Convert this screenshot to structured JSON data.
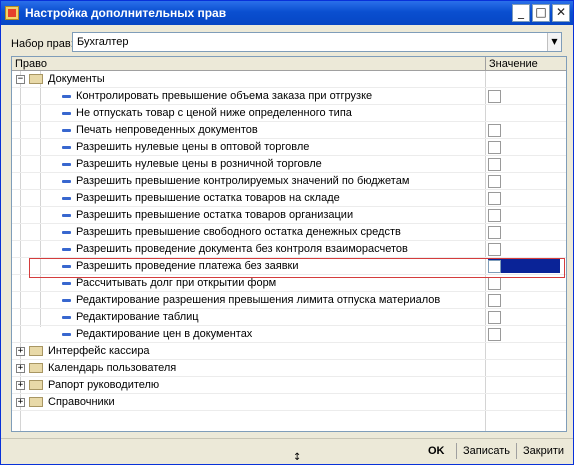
{
  "window": {
    "title": "Настройка дополнительных прав"
  },
  "set": {
    "label": "Набор прав:",
    "value": "Бухгалтер"
  },
  "grid": {
    "col_right": "Право",
    "col_value": "Значение",
    "documents_group": "Документы",
    "rights": [
      "Контролировать превышение объема заказа при отгрузке",
      "Не отпускать товар с ценой ниже определенного типа",
      "Печать непроведенных документов",
      "Разрешить нулевые цены в оптовой торговле",
      "Разрешить нулевые цены в розничной торговле",
      "Разрешить превышение контролируемых значений по бюджетам",
      "Разрешить превышение остатка товаров на складе",
      "Разрешить превышение остатка товаров организации",
      "Разрешить превышение свободного остатка денежных средств",
      "Разрешить проведение документа без контроля взаиморасчетов",
      "Разрешить проведение платежа без заявки",
      "Рассчитывать долг при открытии форм",
      "Редактирование разрешения превышения лимита отпуска материалов",
      "Редактирование таблиц",
      "Редактирование цен в документах"
    ],
    "groups": [
      "Интерфейс кассира",
      "Календарь пользователя",
      "Рапорт руководителю",
      "Справочники"
    ]
  },
  "buttons": {
    "ok": "OK",
    "save": "Записать",
    "close": "Закрити"
  }
}
